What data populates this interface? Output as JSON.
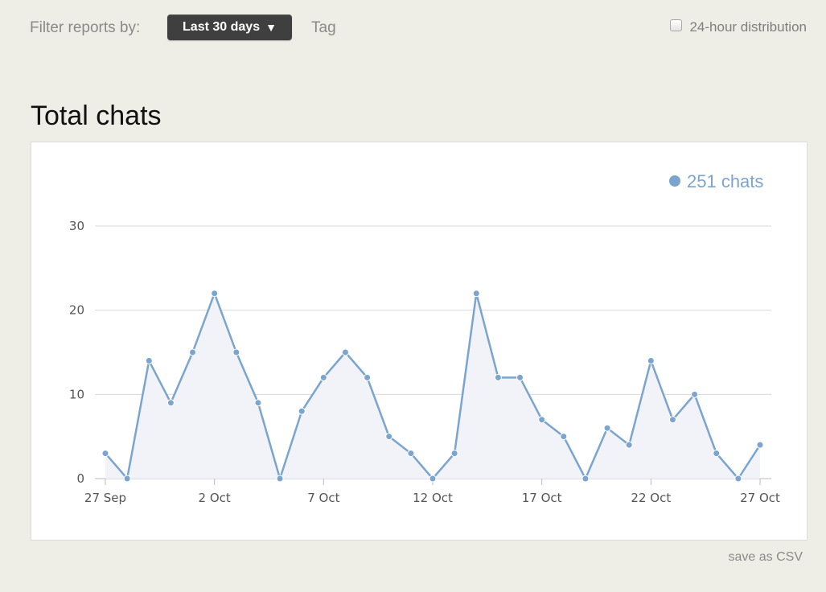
{
  "filter": {
    "label": "Filter reports by:",
    "dropdown_label": "Last 30 days",
    "dropdown_arrow": "▼",
    "tag_label": "Tag",
    "distribution_label": "24-hour distribution",
    "distribution_checked": false
  },
  "section_title": "Total chats",
  "save_csv_label": "save as CSV",
  "colors": {
    "series": "#7ba4cf",
    "area": "#f1f3f8",
    "grid": "#d8d8d8",
    "axis_text": "#555555"
  },
  "chart_data": {
    "type": "area",
    "title": "Total chats",
    "xlabel": "",
    "ylabel": "",
    "ylim": [
      0,
      30
    ],
    "yticks": [
      "0",
      "10",
      "20",
      "30"
    ],
    "grid": true,
    "legend": "top-right",
    "x": [
      "27 Sep",
      "28 Sep",
      "29 Sep",
      "30 Sep",
      "1 Oct",
      "2 Oct",
      "3 Oct",
      "4 Oct",
      "5 Oct",
      "6 Oct",
      "7 Oct",
      "8 Oct",
      "9 Oct",
      "10 Oct",
      "11 Oct",
      "12 Oct",
      "13 Oct",
      "14 Oct",
      "15 Oct",
      "16 Oct",
      "17 Oct",
      "18 Oct",
      "19 Oct",
      "20 Oct",
      "21 Oct",
      "22 Oct",
      "23 Oct",
      "24 Oct",
      "25 Oct",
      "26 Oct",
      "27 Oct"
    ],
    "xtick_labels": [
      "27 Sep",
      "2 Oct",
      "7 Oct",
      "12 Oct",
      "17 Oct",
      "22 Oct",
      "27 Oct"
    ],
    "series": [
      {
        "name": "251 chats",
        "values": [
          3,
          0,
          14,
          9,
          15,
          22,
          15,
          9,
          0,
          8,
          12,
          15,
          12,
          5,
          3,
          0,
          3,
          22,
          12,
          12,
          7,
          5,
          0,
          6,
          4,
          14,
          7,
          10,
          3,
          0,
          4
        ]
      }
    ]
  }
}
